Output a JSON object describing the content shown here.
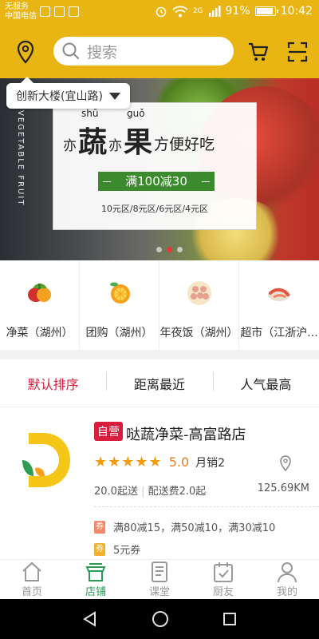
{
  "status_bar": {
    "carrier_line1": "无服务",
    "carrier_line2": "中国电信",
    "signal_label": "2G",
    "battery_percent": "91%",
    "battery_level": 0.91,
    "time": "10:42"
  },
  "header": {
    "search_placeholder": "搜索",
    "location_tip": "创新大楼(宜山路)"
  },
  "banner": {
    "side_text": "VEGETABLE FRUIT",
    "headline_part1": "亦",
    "headline_char1": "蔬",
    "pinyin1": "shū",
    "headline_part2": "亦",
    "headline_char2": "果",
    "pinyin2": "guǒ",
    "headline_part3": "方便好吃",
    "promo": "满100减30",
    "tiers": "10元区/8元区/6元区/4元区",
    "slide_count": 3,
    "active_slide": 1
  },
  "categories": [
    {
      "label": "净菜（湖州）",
      "icon": "vegetables-icon"
    },
    {
      "label": "团购（湖州）",
      "icon": "orange-icon"
    },
    {
      "label": "年夜饭（湖州）",
      "icon": "dumplings-icon"
    },
    {
      "label": "超市（江浙沪...",
      "icon": "seafood-icon"
    }
  ],
  "sort": {
    "default": "默认排序",
    "nearest": "距离最近",
    "popular": "人气最高"
  },
  "store": {
    "badge": "自营",
    "name": "哒蔬净菜-高富路店",
    "stars": "★★★★★",
    "score": "5.0",
    "monthly_sales": "月销2",
    "min_order": "20.0起送",
    "delivery_fee": "配送费2.0起",
    "distance": "125.69KM",
    "promo_reduce_tag": "券",
    "promo_reduce": "满80减15，满50减10，满30减10",
    "promo_coupon_tag": "券",
    "promo_coupon": "5元券"
  },
  "tabs": {
    "home": "首页",
    "stores": "店铺",
    "classroom": "课堂",
    "chef": "厨友",
    "mine": "我的"
  },
  "colors": {
    "brand_yellow": "#e8b512",
    "accent_red": "#d81e3c",
    "active_green": "#2b9a5a"
  }
}
